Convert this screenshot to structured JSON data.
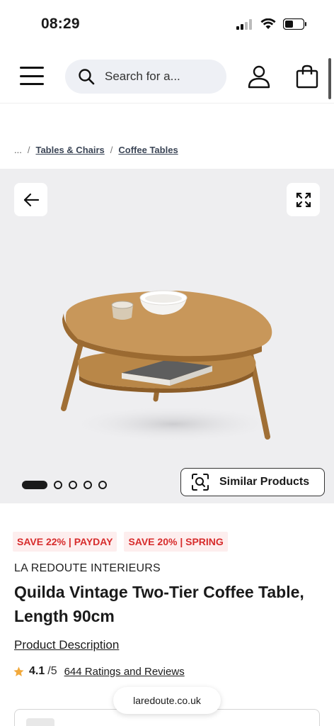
{
  "status_bar": {
    "time": "08:29"
  },
  "header": {
    "search_placeholder": "Search for a..."
  },
  "breadcrumb": {
    "ellipsis": "...",
    "separator": "/",
    "items": [
      "Tables & Chairs",
      "Coffee Tables"
    ]
  },
  "gallery": {
    "similar_label": "Similar Products",
    "total_images": 5,
    "active_index": 0
  },
  "product": {
    "badges": [
      "SAVE 22% | PAYDAY",
      "SAVE 20% | SPRING"
    ],
    "brand": "LA REDOUTE INTERIEURS",
    "title": "Quilda Vintage Two-Tier Coffee Table, Length 90cm",
    "description_link": "Product Description",
    "rating_value": "4.1",
    "rating_max": "/5",
    "ratings_link": "644 Ratings and Reviews"
  },
  "browser": {
    "url": "laredoute.co.uk"
  },
  "colors": {
    "accent_red": "#d72c2c",
    "badge_bg": "#fdeeee",
    "star": "#f2a93b",
    "gallery_bg": "#eeeef0"
  }
}
